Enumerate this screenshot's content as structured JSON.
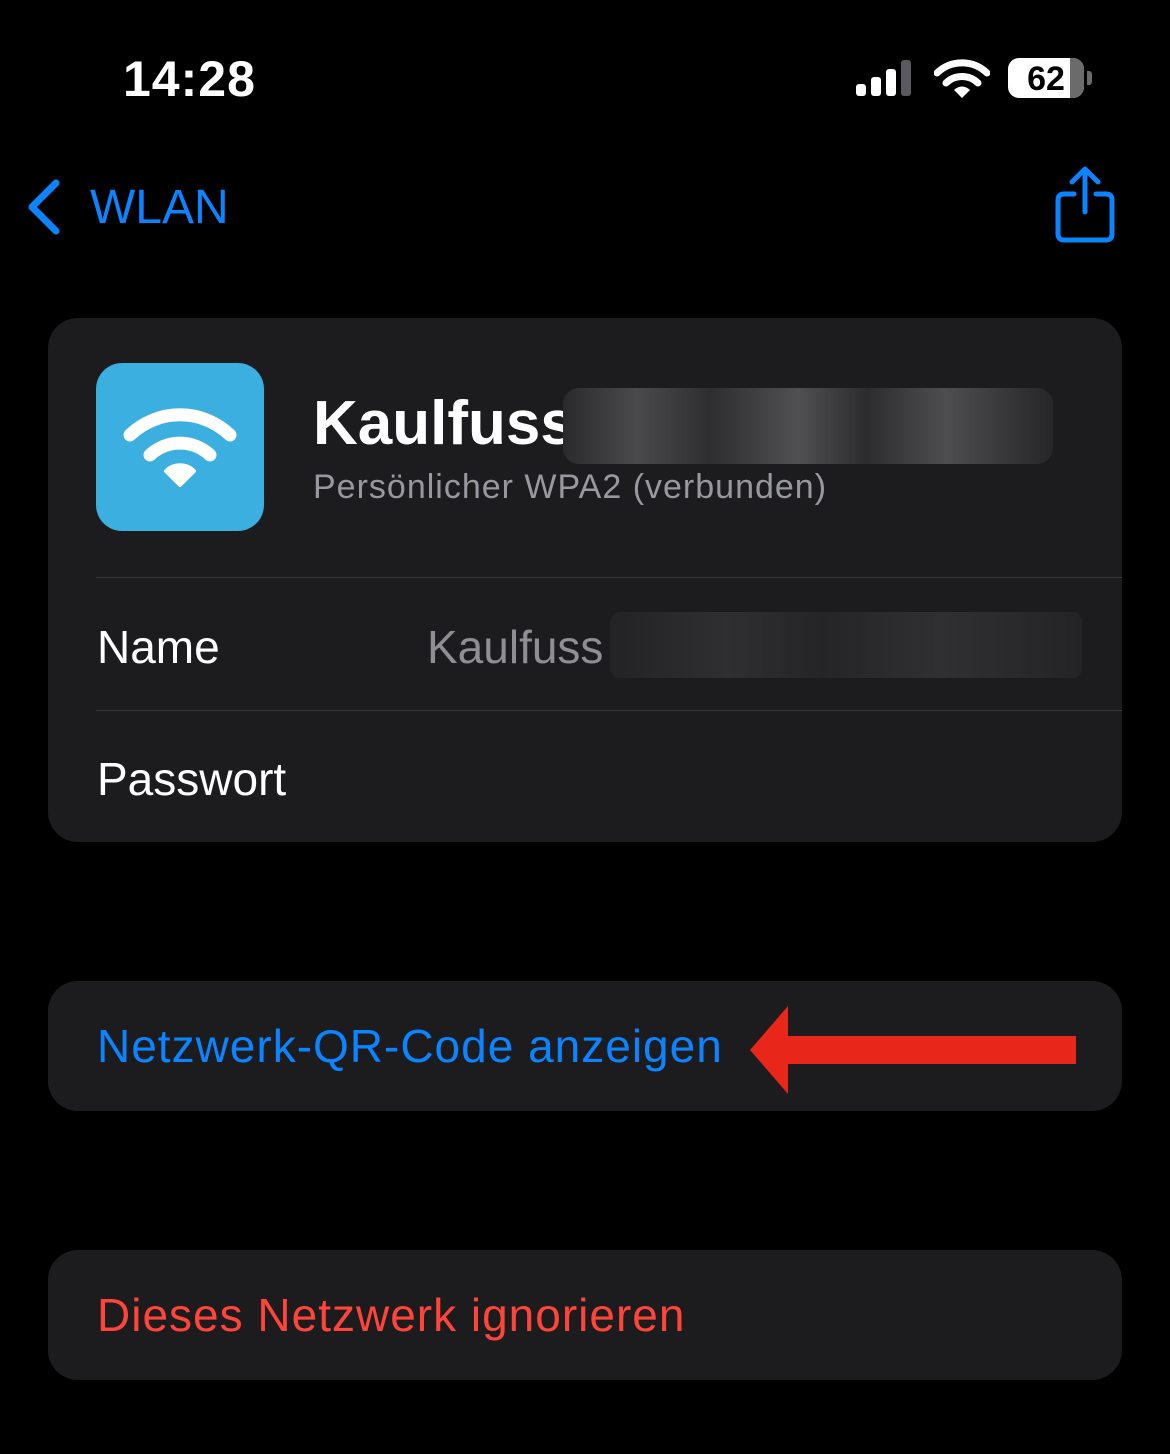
{
  "status_bar": {
    "time": "14:28",
    "signal_bars_active": 3,
    "signal_bars_total": 4,
    "battery_level": "62",
    "battery_percent": 62
  },
  "nav": {
    "back_label": "WLAN",
    "back_icon": "chevron-left-icon",
    "share_icon": "share-icon"
  },
  "network": {
    "icon": "wifi-icon",
    "name_visible": "Kaulfuss",
    "security": "Persönlicher WPA2 (verbunden)"
  },
  "details": {
    "name_label": "Name",
    "name_value_visible": "Kaulfuss",
    "password_label": "Passwort"
  },
  "actions": {
    "show_qr_label": "Netzwerk-QR-Code anzeigen",
    "forget_label": "Dieses Netzwerk ignorieren"
  },
  "colors": {
    "background": "#000000",
    "card": "#1c1c1e",
    "accent_blue": "#0a84ff",
    "destructive_red": "#ff453a",
    "wifi_icon_bg": "#3bafe0",
    "annotation_arrow": "#e8261a"
  }
}
